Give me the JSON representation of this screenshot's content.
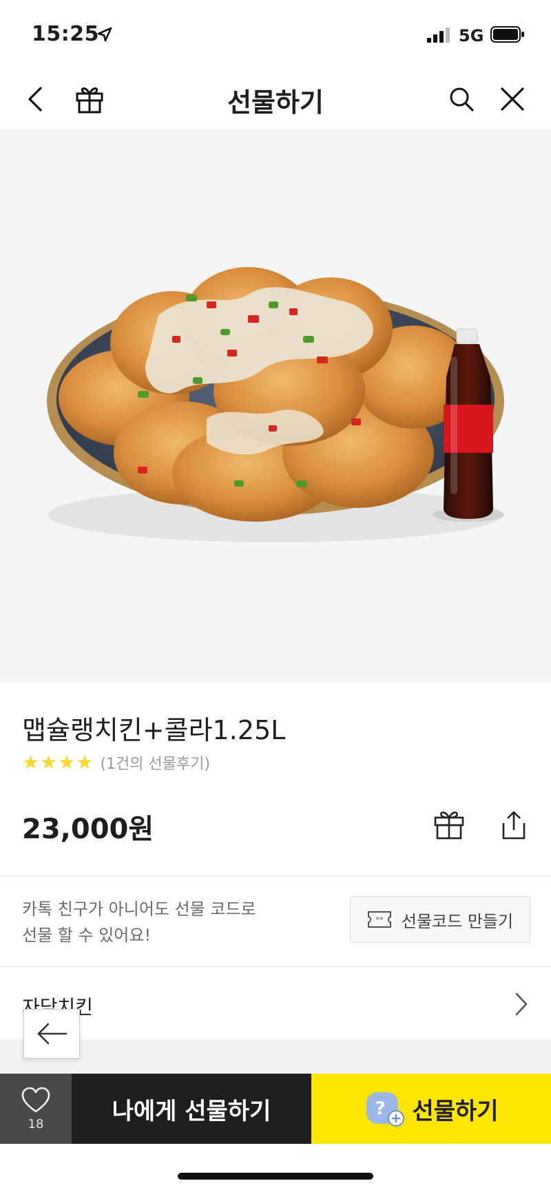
{
  "status_bar": {
    "time": "15:25",
    "network": "5G"
  },
  "header": {
    "title": "선물하기"
  },
  "product": {
    "name": "맵슐랭치킨+콜라1.25L",
    "rating_stars": 4,
    "review_count": "(1건의 선물후기)",
    "price": "23,000원"
  },
  "gift_code": {
    "message_line1": "카톡 친구가 아니어도 선물 코드로",
    "message_line2": "선물 할 수 있어요!",
    "button_label": "선물코드 만들기"
  },
  "brand": {
    "name": "자담치킨"
  },
  "bottom_bar": {
    "like_count": "18",
    "self_gift_label": "나에게 선물하기",
    "gift_label": "선물하기"
  },
  "colors": {
    "accent": "#fee500",
    "dark_button": "#1e1e1e",
    "star": "#f9d92e"
  }
}
